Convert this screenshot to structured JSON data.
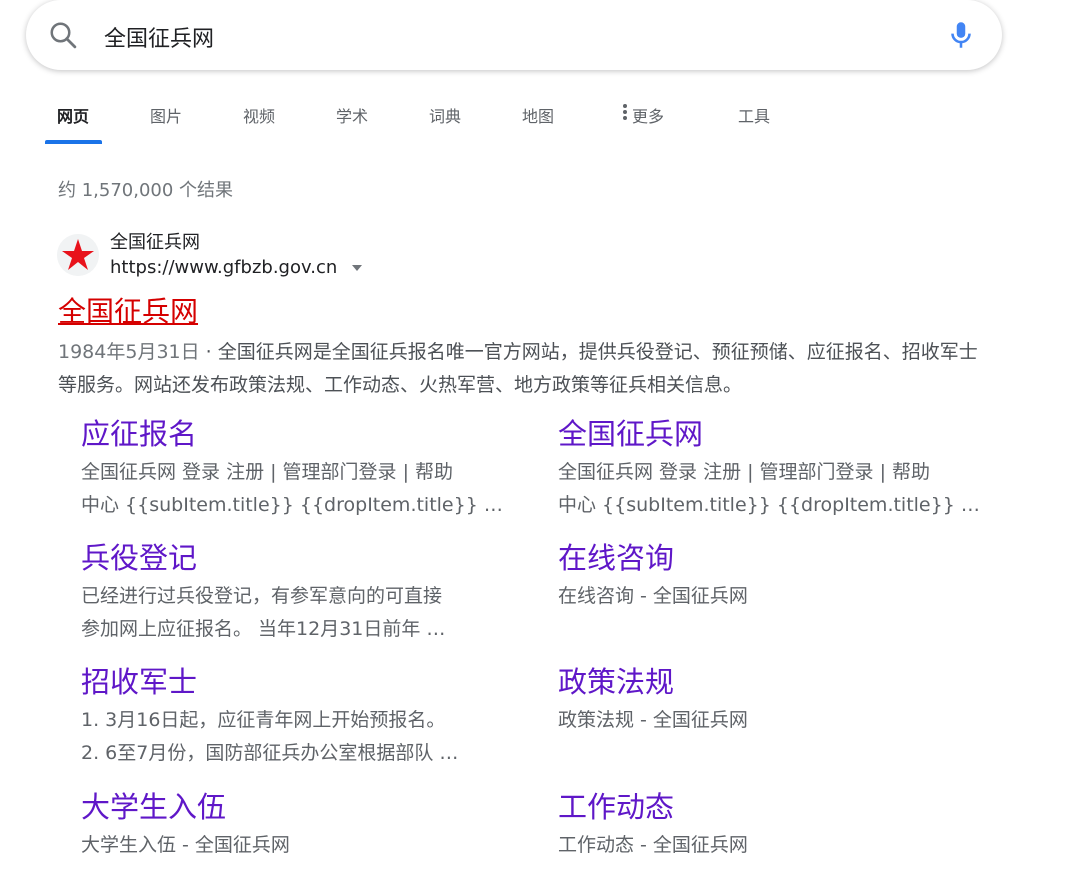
{
  "search": {
    "query": "全国征兵网"
  },
  "tabs": [
    {
      "label": "网页",
      "active": true
    },
    {
      "label": "图片"
    },
    {
      "label": "视频"
    },
    {
      "label": "学术"
    },
    {
      "label": "词典"
    },
    {
      "label": "地图"
    },
    {
      "label": "更多"
    },
    {
      "label": "工具"
    }
  ],
  "stats": "约 1,570,000 个结果",
  "result": {
    "site_name": "全国征兵网",
    "url": "https://www.gfbzb.gov.cn",
    "title": "全国征兵网",
    "date": "1984年5月31日",
    "separator": " · ",
    "snippet": "全国征兵网是全国征兵报名唯一官方网站，提供兵役登记、预征预储、应征报名、招收军士等服务。网站还发布政策法规、工作动态、火热军营、地方政策等征兵相关信息。"
  },
  "sitelinks": [
    {
      "title": "应征报名",
      "lines": [
        "全国征兵网 登录 注册 | 管理部门登录 | 帮助",
        "中心 {{subItem.title}} {{dropItem.title}} …"
      ]
    },
    {
      "title": "全国征兵网",
      "lines": [
        "全国征兵网 登录 注册 | 管理部门登录 | 帮助",
        "中心 {{subItem.title}} {{dropItem.title}} …"
      ]
    },
    {
      "title": "兵役登记",
      "lines": [
        "已经进行过兵役登记，有参军意向的可直接",
        "参加网上应征报名。 当年12月31日前年 …"
      ]
    },
    {
      "title": "在线咨询",
      "lines": [
        "在线咨询 - 全国征兵网"
      ]
    },
    {
      "title": "招收军士",
      "lines": [
        "1. 3月16日起，应征青年网上开始预报名。",
        "2. 6至7月份，国防部征兵办公室根据部队 …"
      ]
    },
    {
      "title": "政策法规",
      "lines": [
        "政策法规 - 全国征兵网"
      ]
    },
    {
      "title": "大学生入伍",
      "lines": [
        "大学生入伍 - 全国征兵网"
      ]
    },
    {
      "title": "工作动态",
      "lines": [
        "工作动态 - 全国征兵网"
      ]
    }
  ],
  "colors": {
    "link_visited": "#5f17c8",
    "title_red": "#d50000",
    "accent": "#1a73e8",
    "favicon_star": "#e8121b"
  },
  "icons": {
    "search": "search-icon",
    "mic": "microphone-icon",
    "more": "vertical-dots-icon",
    "url_menu": "caret-down-icon",
    "favicon": "red-star-icon"
  }
}
